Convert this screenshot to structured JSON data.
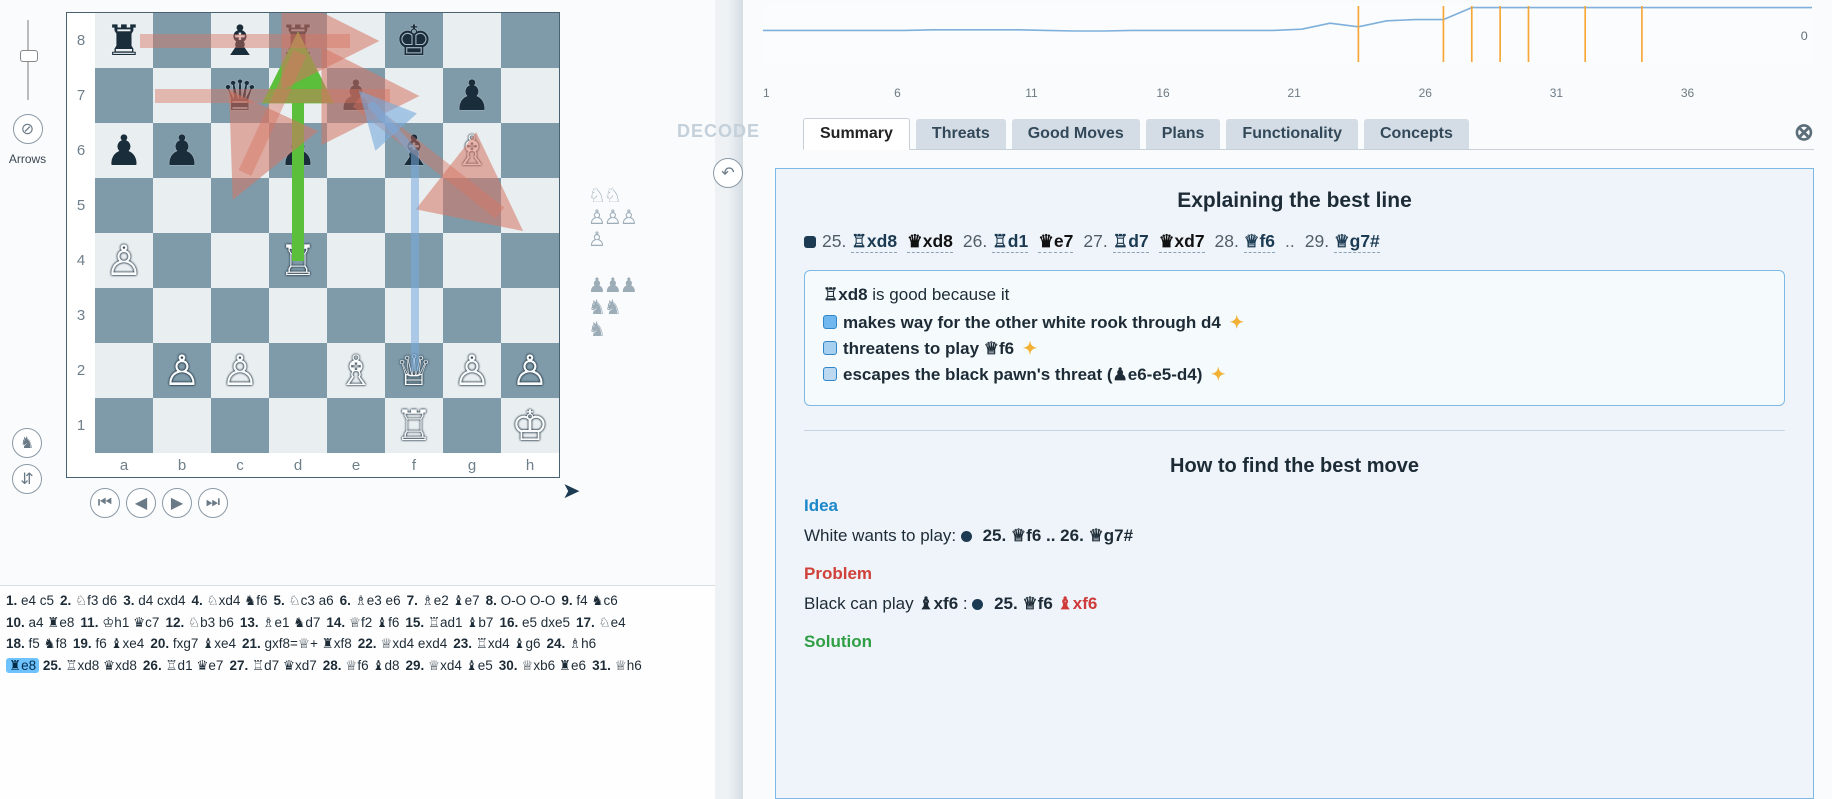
{
  "sidebar": {
    "arrows_label": "Arrows"
  },
  "board": {
    "files": [
      "a",
      "b",
      "c",
      "d",
      "e",
      "f",
      "g",
      "h"
    ],
    "ranks": [
      "8",
      "7",
      "6",
      "5",
      "4",
      "3",
      "2",
      "1"
    ],
    "pieces": {
      "a8": "♜",
      "c8": "♝",
      "d8": "♜",
      "f8": "♚",
      "c7": "♛",
      "e7": "♟",
      "g7": "♟",
      "a6": "♟",
      "b6": "♟",
      "d6": "♟",
      "f6": "♝",
      "g6": "♗",
      "a4": "♙",
      "d4": "♖",
      "b2": "♙",
      "c2": "♙",
      "e2": "♗",
      "f2": "♕",
      "g2": "♙",
      "h2": "♙",
      "f1": "♖",
      "h1": "♔"
    }
  },
  "captured": {
    "white_caps": "♘♘\n♙♙♙\n♙",
    "black_caps": "♟♟♟\n♞♞\n♞"
  },
  "chart_data": {
    "type": "line",
    "x": [
      1,
      2,
      3,
      4,
      5,
      6,
      7,
      8,
      9,
      10,
      11,
      12,
      13,
      14,
      15,
      16,
      17,
      18,
      19,
      20,
      21,
      22,
      23,
      24,
      25,
      26,
      27,
      28,
      29,
      30,
      31,
      32,
      33,
      34,
      35,
      36,
      37,
      38
    ],
    "eval": [
      0.3,
      0.3,
      0.3,
      0.3,
      0.3,
      0.3,
      0.35,
      0.35,
      0.35,
      0.35,
      0.3,
      0.25,
      0.25,
      0.3,
      0.3,
      0.3,
      0.3,
      0.3,
      0.3,
      0.4,
      0.9,
      0.6,
      1.1,
      1.2,
      1.2,
      2.2,
      2.2,
      2.2,
      2.2,
      2.2,
      2.2,
      2.2,
      2.2,
      2.2,
      2.2,
      2.2,
      2.2,
      2.2
    ],
    "ylim": [
      -2.5,
      2.5
    ],
    "xlabel": "",
    "ylabel": "",
    "xticks": [
      1,
      6,
      11,
      16,
      21,
      26,
      31,
      36
    ],
    "markers": [
      22,
      25,
      26,
      27,
      28,
      30,
      32
    ],
    "end_label": "0"
  },
  "decode_label": "DECODE",
  "tabs": [
    "Summary",
    "Threats",
    "Good Moves",
    "Plans",
    "Functionality",
    "Concepts"
  ],
  "active_tab": 0,
  "explain": {
    "title": "Explaining the best line",
    "line": [
      {
        "n": "25.",
        "piece": "♖",
        "m": "xd8",
        "side": "w",
        "bullet": "filled"
      },
      {
        "piece": "♛",
        "m": "xd8",
        "side": "b"
      },
      {
        "n": "26.",
        "piece": "♖",
        "m": "d1",
        "side": "w"
      },
      {
        "piece": "♛",
        "m": "e7",
        "side": "b"
      },
      {
        "n": "27.",
        "piece": "♖",
        "m": "d7",
        "side": "w"
      },
      {
        "piece": "♛",
        "m": "xd7",
        "side": "b"
      },
      {
        "n": "28.",
        "piece": "♕",
        "m": "f6",
        "side": "w"
      },
      {
        "dots": ".."
      },
      {
        "n": "29.",
        "piece": "♕",
        "m": "g7#",
        "side": "w"
      }
    ],
    "goodbox": {
      "lead_piece": "♖",
      "lead_move": "xd8",
      "lead_tail": "  is good because it",
      "items": [
        {
          "txt": "makes way for the other white rook through d4"
        },
        {
          "txt": "threatens to play ♕f6"
        },
        {
          "txt": "escapes the black pawn's threat (♟e6-e5-d4)"
        }
      ]
    },
    "how_title": "How to find the best move",
    "idea_label": "Idea",
    "idea_text_a": "White wants to play: ",
    "idea_moves": "25. ♕f6  ..  26. ♕g7#",
    "problem_label": "Problem",
    "problem_text_a": "Black can play ",
    "problem_bold": "♝xf6",
    "problem_colon": " : ",
    "problem_moves": "25. ♕f6  ",
    "problem_red": "♝xf6",
    "solution_label": "Solution"
  },
  "notation": {
    "moves": [
      [
        "1.",
        "e4",
        "c5"
      ],
      [
        "2.",
        "♘f3",
        "d6"
      ],
      [
        "3.",
        "d4",
        "cxd4"
      ],
      [
        "4.",
        "♘xd4",
        "♞f6"
      ],
      [
        "5.",
        "♘c3",
        "a6"
      ],
      [
        "6.",
        "♗e3",
        "e6"
      ],
      [
        "7.",
        "♗e2",
        "♝e7"
      ],
      [
        "8.",
        "O-O",
        "O-O"
      ],
      [
        "9.",
        "f4",
        "♞c6"
      ],
      [
        "10.",
        "a4",
        "♜e8"
      ],
      [
        "11.",
        "♔h1",
        "♛c7"
      ],
      [
        "12.",
        "♘b3",
        "b6"
      ],
      [
        "13.",
        "♗e1",
        "♞d7"
      ],
      [
        "14.",
        "♕f2",
        "♝f6"
      ],
      [
        "15.",
        "♖ad1",
        "♝b7"
      ],
      [
        "16.",
        "e5",
        "dxe5"
      ],
      [
        "17.",
        "♘e4",
        ""
      ],
      [
        "18.",
        "f5",
        "♞f8"
      ],
      [
        "19.",
        "f6",
        "♝xe4"
      ],
      [
        "20.",
        "fxg7",
        "♝xe4"
      ],
      [
        "21.",
        "gxf8=♕+",
        "♜xf8"
      ],
      [
        "22.",
        "♕xd4",
        "exd4"
      ],
      [
        "23.",
        "♖xd4",
        "♝g6"
      ],
      [
        "24.",
        "♗h6",
        ""
      ]
    ],
    "current": "♜e8",
    "moves2": [
      [
        "25.",
        "♖xd8",
        "♛xd8"
      ],
      [
        "26.",
        "♖d1",
        "♛e7"
      ],
      [
        "27.",
        "♖d7",
        "♛xd7"
      ],
      [
        "28.",
        "♕f6",
        "♝d8"
      ],
      [
        "29.",
        "♕xd4",
        "♝e5"
      ],
      [
        "30.",
        "♕xb6",
        "♜e6"
      ],
      [
        "31.",
        "♕h6",
        ""
      ]
    ]
  }
}
